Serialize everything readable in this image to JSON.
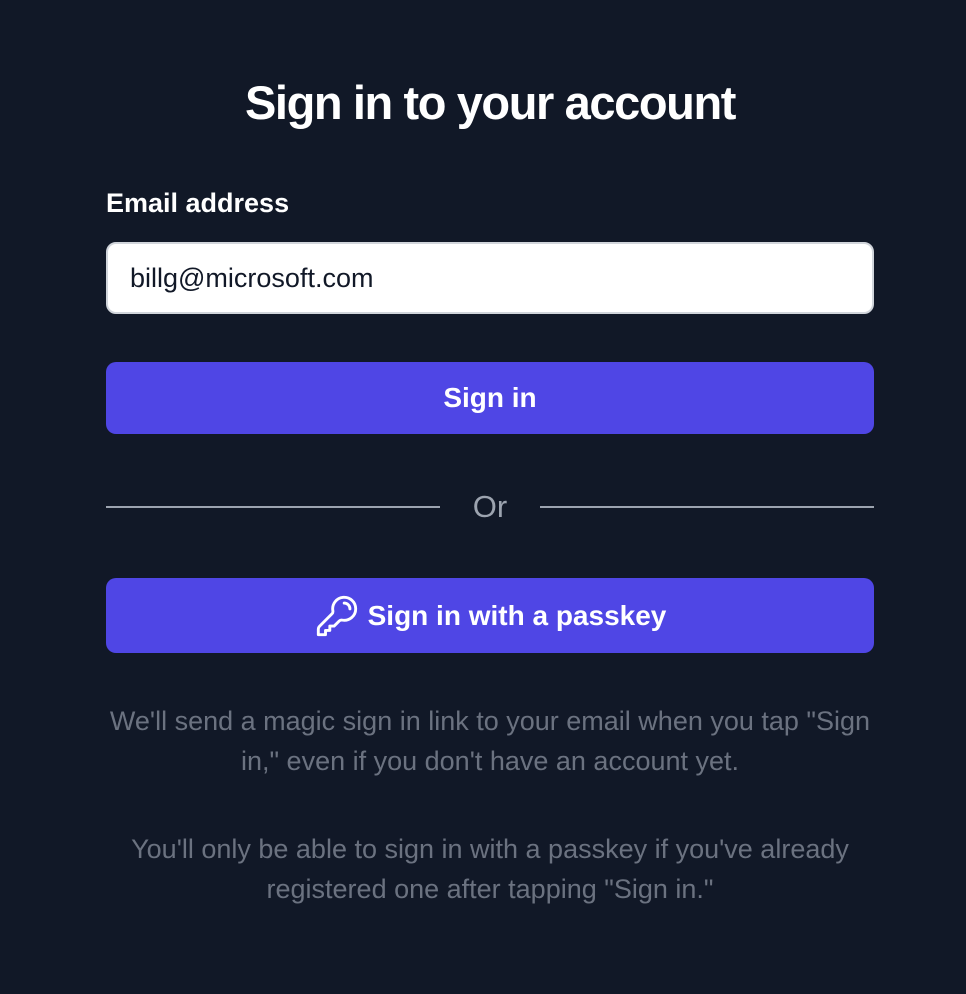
{
  "page": {
    "title": "Sign in to your account"
  },
  "form": {
    "email_label": "Email address",
    "email_value": "billg@microsoft.com",
    "sign_in_label": "Sign in",
    "divider_text": "Or",
    "passkey_label": "Sign in with a passkey",
    "passkey_icon": "key-icon"
  },
  "notes": {
    "magic_link": "We'll send a magic sign in link to your email when you tap \"Sign in,\" even if you don't have an account yet.",
    "passkey": "You'll only be able to sign in with a passkey if you've already registered one after tapping \"Sign in.\""
  },
  "colors": {
    "background": "#111827",
    "primary_button": "#4f46e5",
    "muted_text": "#6b7280",
    "divider": "#9ca3af"
  }
}
